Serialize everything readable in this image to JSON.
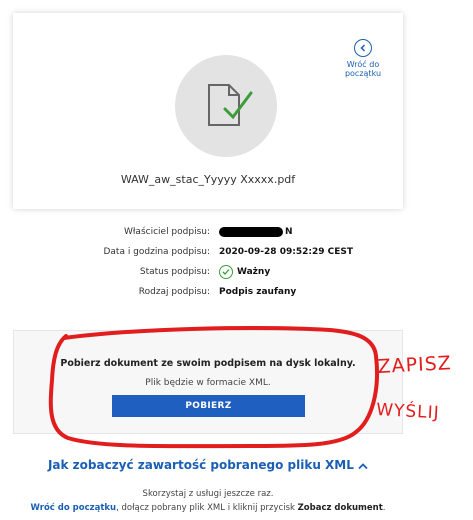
{
  "file_card": {
    "back_label_line1": "Wróć do",
    "back_label_line2": "początku",
    "file_name": "WAW_aw_stac_Yyyyy Xxxxx.pdf"
  },
  "signature": {
    "owner_label": "Właściciel podpisu:",
    "owner_value_visible": "N",
    "datetime_label": "Data i godzina podpisu:",
    "datetime_value": "2020-09-28 09:52:29 CEST",
    "status_label": "Status podpisu:",
    "status_value": "Ważny",
    "type_label": "Rodzaj podpisu:",
    "type_value": "Podpis zaufany"
  },
  "download": {
    "title": "Pobierz dokument ze swoim podpisem na dysk lokalny.",
    "note": "Plik będzie w formacie XML.",
    "button_label": "POBIERZ"
  },
  "annotations": {
    "word1": "ZAPISZ",
    "word2": "WYŚLIJ"
  },
  "xml_link": "Jak zobaczyć zawartość pobranego pliku XML",
  "footer": {
    "line1": "Skorzystaj z usługi jeszcze raz.",
    "link": "Wróć do początku",
    "middle": ", dołącz pobrany plik XML i kliknij przycisk ",
    "bold": "Zobacz dokument",
    "end": "."
  },
  "colors": {
    "accent_blue": "#1b5fb4",
    "button_blue": "#1f5fbf",
    "valid_green": "#3a9d3a",
    "annotation_red": "#e11d1d"
  }
}
